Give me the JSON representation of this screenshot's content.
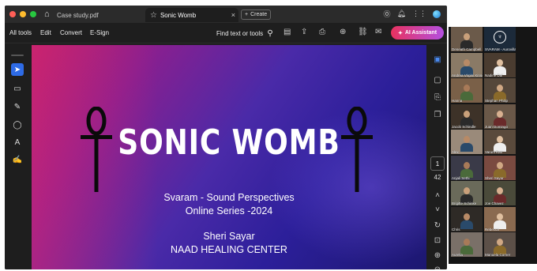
{
  "window": {
    "tabs": [
      {
        "label": "Case study.pdf"
      },
      {
        "label": "Sonic Womb",
        "close": "×"
      }
    ],
    "create_label": "Create",
    "colors": {
      "accent": "#2e6be6",
      "ai_gradient_start": "#e8325f",
      "ai_gradient_end": "#b44fe0"
    }
  },
  "menubar": {
    "items": [
      "All tools",
      "Edit",
      "Convert",
      "E-Sign"
    ],
    "find_label": "Find text or tools",
    "ai_assistant_label": "AI Assistant"
  },
  "slide": {
    "title": "SONIC WOMB",
    "line1": "Svaram - Sound Perspectives",
    "line2": "Online Series -2024",
    "line3": "Sheri Sayar",
    "line4": "NAAD HEALING CENTER"
  },
  "pager": {
    "current": "1",
    "total": "42"
  },
  "participants": [
    {
      "name": "Deneath Campbell"
    },
    {
      "name": "SVARAM - Aurovilla Instrum."
    },
    {
      "name": "Andrea Virgini Kinscher"
    },
    {
      "name": "Nadine Dal"
    },
    {
      "name": "Hanna"
    },
    {
      "name": "Stephan Philip"
    },
    {
      "name": "Jacob Schindle"
    },
    {
      "name": "Juan Domingo"
    },
    {
      "name": "Alex"
    },
    {
      "name": "Varuni Rao"
    },
    {
      "name": "Anjali Sethi"
    },
    {
      "name": "Sheri Sayar"
    },
    {
      "name": "Brigitte Schinke"
    },
    {
      "name": "Joe Chavez"
    },
    {
      "name": "Chris"
    },
    {
      "name": "Rebecca"
    },
    {
      "name": "Aurelia"
    },
    {
      "name": "Manuela Corner"
    }
  ]
}
